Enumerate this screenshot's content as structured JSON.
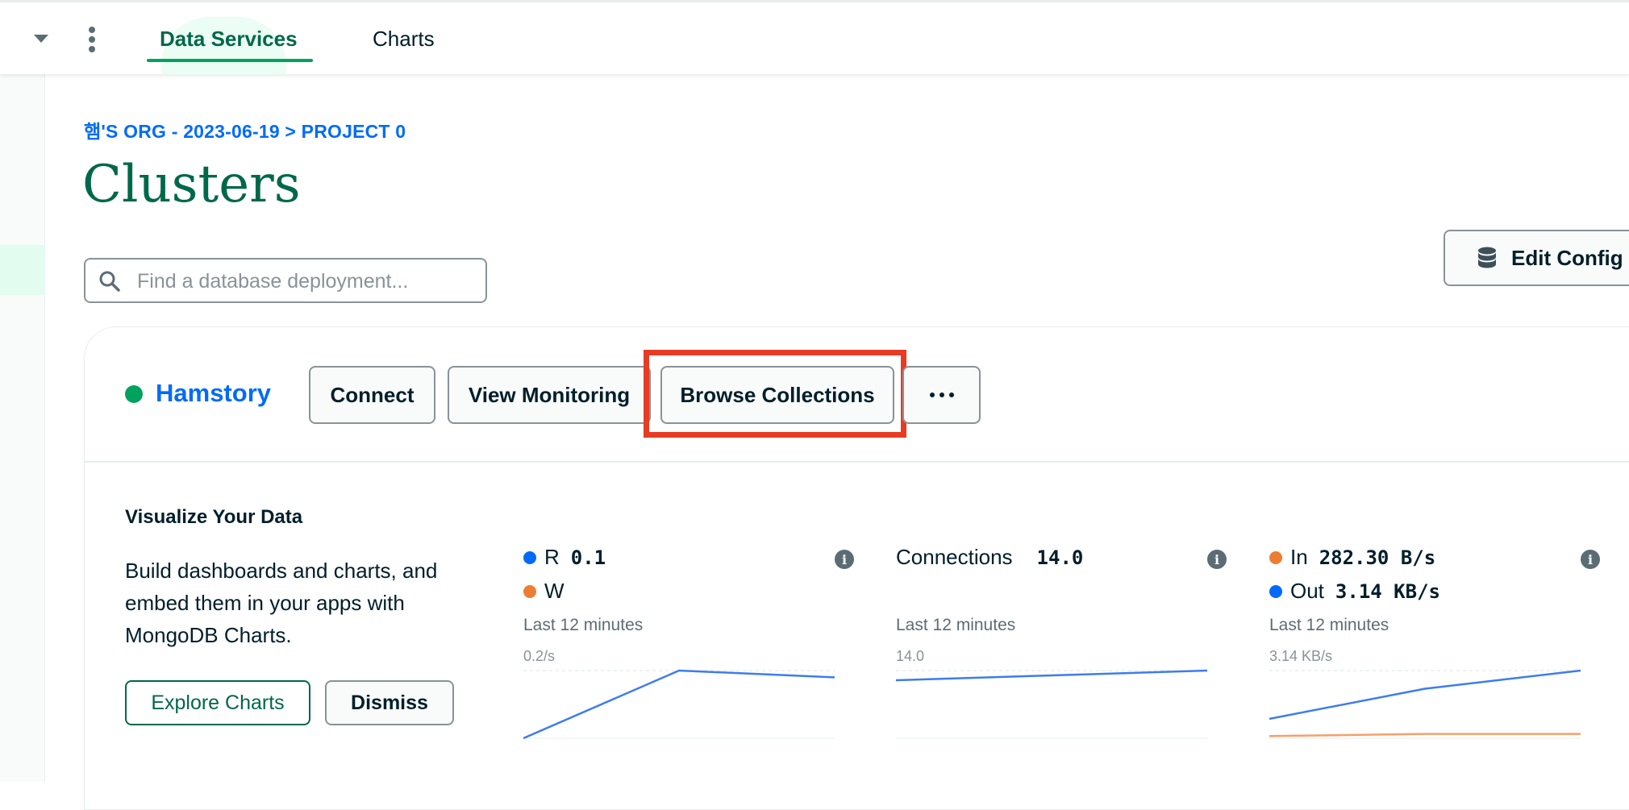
{
  "nav": {
    "tabs": [
      {
        "label": "Data Services",
        "active": true
      },
      {
        "label": "Charts",
        "active": false
      }
    ]
  },
  "breadcrumb": "햄'S ORG - 2023-06-19 > PROJECT 0",
  "page_title": "Clusters",
  "search": {
    "placeholder": "Find a database deployment...",
    "value": ""
  },
  "edit_config_label": "Edit Config",
  "cluster": {
    "name": "Hamstory",
    "status_color": "#00a35c",
    "buttons": {
      "connect": "Connect",
      "view_monitoring": "View Monitoring",
      "browse_collections": "Browse Collections"
    }
  },
  "visualize": {
    "title": "Visualize Your Data",
    "description": "Build dashboards and charts, and embed them in your apps with MongoDB Charts.",
    "explore_label": "Explore Charts",
    "dismiss_label": "Dismiss"
  },
  "metrics": [
    {
      "legend": [
        {
          "label": "R",
          "value": "0.1",
          "color": "#016bf8"
        },
        {
          "label": "W",
          "value": "",
          "color": "#ed7d31"
        }
      ],
      "period": "Last 12 minutes",
      "max_label": "0.2/s",
      "series": [
        {
          "color": "#3d7cf0",
          "values": [
            0.0,
            0.2,
            0.18
          ]
        }
      ],
      "ymax": 0.2
    },
    {
      "legend": [
        {
          "label": "Connections",
          "value": "14.0",
          "color": ""
        }
      ],
      "period": "Last 12 minutes",
      "max_label": "14.0",
      "series": [
        {
          "color": "#3d7cf0",
          "values": [
            12.0,
            13.0,
            14.0
          ]
        }
      ],
      "ymax": 14.0
    },
    {
      "legend": [
        {
          "label": "In",
          "value": "282.30 B/s",
          "color": "#ed7d31"
        },
        {
          "label": "Out",
          "value": "3.14 KB/s",
          "color": "#016bf8"
        }
      ],
      "period": "Last 12 minutes",
      "max_label": "3.14 KB/s",
      "series": [
        {
          "color": "#3d7cf0",
          "values": [
            0.9,
            2.3,
            3.14
          ]
        },
        {
          "color": "#f4a06a",
          "values": [
            0.1,
            0.2,
            0.2
          ]
        }
      ],
      "ymax": 3.14
    }
  ]
}
